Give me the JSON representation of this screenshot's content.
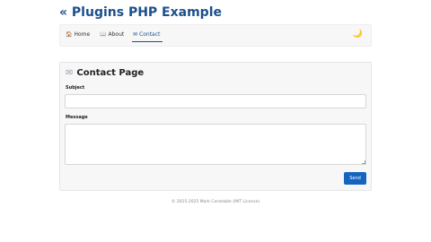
{
  "header": {
    "title": "« Plugins PHP Example"
  },
  "nav": {
    "items": [
      {
        "label": "Home",
        "icon": "home-icon",
        "glyph": "🏠"
      },
      {
        "label": "About",
        "icon": "book-icon",
        "glyph": "📖"
      },
      {
        "label": "Contact",
        "icon": "envelope-icon",
        "glyph": "✉"
      }
    ],
    "active": "Contact",
    "theme_toggle": {
      "icon": "moon-icon",
      "glyph": "🌙"
    }
  },
  "contact": {
    "title": "Contact Page",
    "title_glyph": "✉",
    "subject_label": "Subject",
    "subject_value": "",
    "message_label": "Message",
    "message_value": "",
    "send_label": "Send"
  },
  "footer": {
    "text": "© 2015-2025 Mark Constable (MIT License)"
  },
  "colors": {
    "accent": "#1b4f8a",
    "button": "#1565c0",
    "panel": "#f7f7f7"
  }
}
